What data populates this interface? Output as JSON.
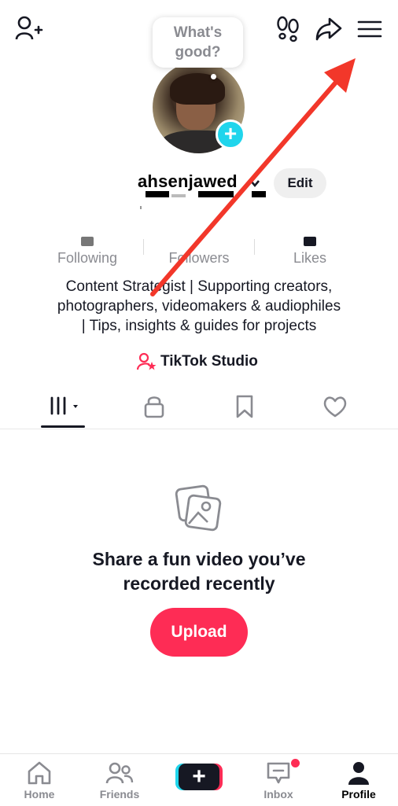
{
  "header": {
    "add_friend_icon": "person-plus-icon",
    "footsteps_icon": "footsteps-icon",
    "share_icon": "share-arrow-icon",
    "menu_icon": "hamburger-menu-icon"
  },
  "bubble": {
    "line1": "What's",
    "line2": "good?"
  },
  "profile": {
    "username": "ahsenjawed",
    "edit_label": "Edit",
    "avatar_add_label": "+"
  },
  "stats": [
    {
      "label": "Following"
    },
    {
      "label": "Followers"
    },
    {
      "label": "Likes"
    }
  ],
  "bio": {
    "line1": "Content Strategist | Supporting creators,",
    "line2": "photographers, videomakers & audiophiles",
    "line3": "| Tips, insights & guides for projects"
  },
  "studio": {
    "label": "TikTok Studio"
  },
  "tabs": [
    {
      "icon": "grid-columns-icon",
      "active": true
    },
    {
      "icon": "lock-icon"
    },
    {
      "icon": "bookmark-icon"
    },
    {
      "icon": "heart-icon"
    }
  ],
  "empty_state": {
    "icon": "photos-icon",
    "line1": "Share a fun video you’ve",
    "line2": "recorded recently",
    "button": "Upload"
  },
  "nav": {
    "home": "Home",
    "friends": "Friends",
    "create_symbol": "+",
    "inbox": "Inbox",
    "profile": "Profile"
  },
  "colors": {
    "accent": "#fe2c55",
    "avatar_add": "#20d5ec",
    "annotation_arrow": "#f2372a"
  }
}
